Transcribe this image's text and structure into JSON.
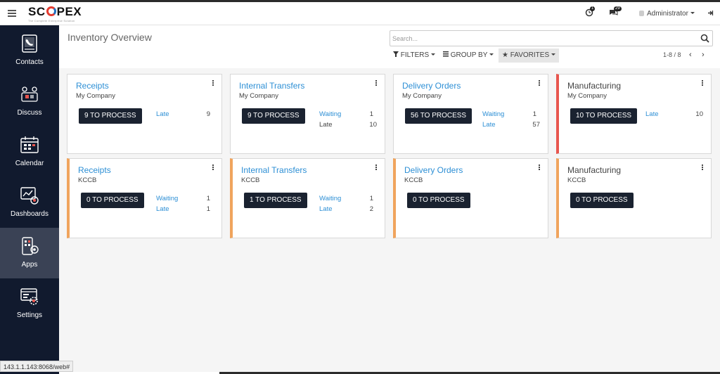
{
  "app": {
    "logo_text_1": "SC",
    "logo_text_2": "PEX",
    "logo_tagline": "The Complete Enterprise Solution",
    "activity_count": "1",
    "message_count": "29",
    "user_name": "Administrator",
    "accent_color": "#2d8fd5",
    "sidebar_color": "#111a2e"
  },
  "sidebar": {
    "items": [
      {
        "label": "Contacts",
        "icon": "contacts-icon"
      },
      {
        "label": "Discuss",
        "icon": "discuss-icon"
      },
      {
        "label": "Calendar",
        "icon": "calendar-icon"
      },
      {
        "label": "Dashboards",
        "icon": "dashboards-icon"
      },
      {
        "label": "Apps",
        "icon": "apps-icon",
        "active": true
      },
      {
        "label": "Settings",
        "icon": "settings-icon"
      }
    ]
  },
  "control_panel": {
    "breadcrumb": "Inventory Overview",
    "search_placeholder": "Search...",
    "filters_label": "FILTERS",
    "group_by_label": "GROUP BY",
    "favorites_label": "FAVORITES",
    "pager": "1-8 / 8"
  },
  "cards": [
    {
      "title": "Receipts",
      "company": "My Company",
      "process": "9 TO PROCESS",
      "stats": [
        {
          "label": "Late",
          "value": "9"
        }
      ]
    },
    {
      "title": "Internal Transfers",
      "company": "My Company",
      "process": "9 TO PROCESS",
      "stats": [
        {
          "label": "Waiting",
          "value": "1"
        },
        {
          "label": "Late",
          "value": "10"
        }
      ]
    },
    {
      "title": "Delivery Orders",
      "company": "My Company",
      "process": "56 TO PROCESS",
      "stats": [
        {
          "label": "Waiting",
          "value": "1"
        },
        {
          "label": "Late",
          "value": "57"
        }
      ]
    },
    {
      "title": "Manufacturing",
      "company": "My Company",
      "process": "10 TO PROCESS",
      "stats": [
        {
          "label": "Late",
          "value": "10"
        }
      ]
    },
    {
      "title": "Receipts",
      "company": "KCCB",
      "process": "0 TO PROCESS",
      "stats": [
        {
          "label": "Waiting",
          "value": "1"
        },
        {
          "label": "Late",
          "value": "1"
        }
      ]
    },
    {
      "title": "Internal Transfers",
      "company": "KCCB",
      "process": "1 TO PROCESS",
      "stats": [
        {
          "label": "Waiting",
          "value": "1"
        },
        {
          "label": "Late",
          "value": "2"
        }
      ]
    },
    {
      "title": "Delivery Orders",
      "company": "KCCB",
      "process": "0 TO PROCESS",
      "stats": []
    },
    {
      "title": "Manufacturing",
      "company": "KCCB",
      "process": "0 TO PROCESS",
      "stats": []
    }
  ],
  "status_url": "143.1.1.143:8068/web#"
}
